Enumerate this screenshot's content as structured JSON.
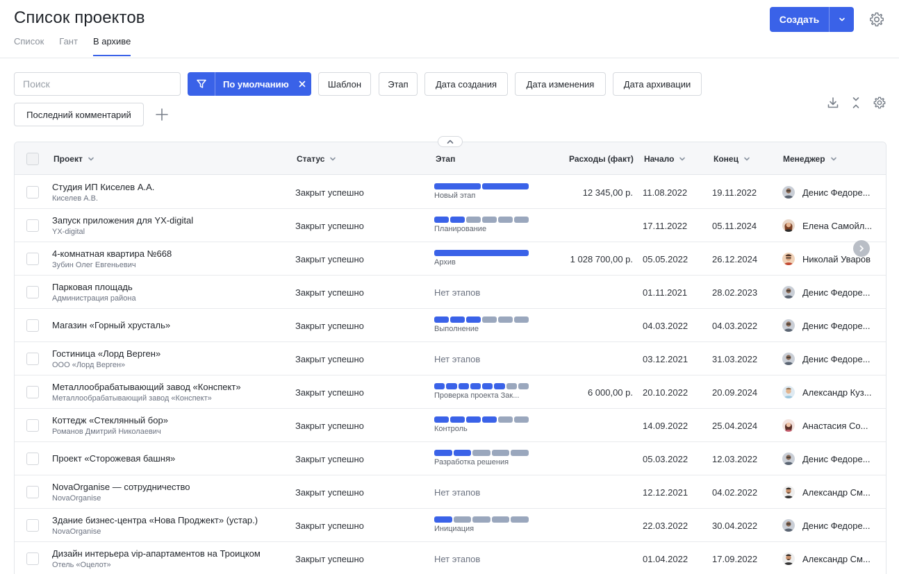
{
  "header": {
    "title": "Список проектов",
    "tabs": [
      {
        "label": "Список"
      },
      {
        "label": "Гант"
      },
      {
        "label": "В архиве"
      }
    ],
    "create_label": "Создать"
  },
  "filters": {
    "search_placeholder": "Поиск",
    "active_filter": "По умолчанию",
    "chips": [
      "Шаблон",
      "Этап",
      "Дата создания",
      "Дата изменения",
      "Дата архивации",
      "Последний комментарий"
    ]
  },
  "colors": {
    "accent": "#3a62e8",
    "stage_done": "#3a62e8",
    "stage_todo": "#9aa7bd"
  },
  "table": {
    "columns": {
      "project": "Проект",
      "status": "Статус",
      "stage": "Этап",
      "expenses": "Расходы (факт)",
      "start": "Начало",
      "end": "Конец",
      "manager": "Менеджер"
    },
    "rows": [
      {
        "name": "Студия ИП Киселев А.А.",
        "client": "Киселев А.В.",
        "status": "Закрыт успешно",
        "stage": {
          "label": "Новый этап",
          "done": 2,
          "total": 2
        },
        "expenses": "12 345,00 р.",
        "start": "11.08.2022",
        "end": "19.11.2022",
        "manager": "Денис Федоре...",
        "avatar": "m1"
      },
      {
        "name": "Запуск приложения для YX-digital",
        "client": "YX-digital",
        "status": "Закрыт успешно",
        "stage": {
          "label": "Планирование",
          "done": 2,
          "total": 6
        },
        "expenses": "",
        "start": "17.11.2022",
        "end": "05.11.2024",
        "manager": "Елена Самойл...",
        "avatar": "f1"
      },
      {
        "name": "4-комнатная квартира №668",
        "client": "Зубин Олег Евгеньевич",
        "status": "Закрыт успешно",
        "stage": {
          "label": "Архив",
          "done": 1,
          "total": 1
        },
        "expenses": "1 028 700,00 р.",
        "start": "05.05.2022",
        "end": "26.12.2024",
        "manager": "Николай Уваров",
        "avatar": "m2"
      },
      {
        "name": "Парковая площадь",
        "client": "Администрация района",
        "status": "Закрыт успешно",
        "stage": null,
        "no_stage": "Нет этапов",
        "expenses": "",
        "start": "01.11.2021",
        "end": "28.02.2023",
        "manager": "Денис Федоре...",
        "avatar": "m1"
      },
      {
        "name": "Магазин «Горный хрусталь»",
        "client": "",
        "status": "Закрыт успешно",
        "stage": {
          "label": "Выполнение",
          "done": 3,
          "total": 6
        },
        "expenses": "",
        "start": "04.03.2022",
        "end": "04.03.2022",
        "manager": "Денис Федоре...",
        "avatar": "m1"
      },
      {
        "name": "Гостиница «Лорд Верген»",
        "client": "ООО «Лорд Верген»",
        "status": "Закрыт успешно",
        "stage": null,
        "no_stage": "Нет этапов",
        "expenses": "",
        "start": "03.12.2021",
        "end": "31.03.2022",
        "manager": "Денис Федоре...",
        "avatar": "m1"
      },
      {
        "name": "Металлообрабатывающий завод «Конспект»",
        "client": "Металлообрабатывающий завод «Конспект»",
        "status": "Закрыт успешно",
        "stage": {
          "label": "Проверка проекта Зак...",
          "done": 6,
          "total": 8
        },
        "expenses": "6 000,00 р.",
        "start": "20.10.2022",
        "end": "20.09.2024",
        "manager": "Александр Куз...",
        "avatar": "m3"
      },
      {
        "name": "Коттедж «Стеклянный бор»",
        "client": "Романов Дмитрий Николаевич",
        "status": "Закрыт успешно",
        "stage": {
          "label": "Контроль",
          "done": 4,
          "total": 6
        },
        "expenses": "",
        "start": "14.09.2022",
        "end": "25.04.2024",
        "manager": "Анастасия Со...",
        "avatar": "f2"
      },
      {
        "name": "Проект «Сторожевая башня»",
        "client": "",
        "status": "Закрыт успешно",
        "stage": {
          "label": "Разработка решения",
          "done": 2,
          "total": 5
        },
        "expenses": "",
        "start": "05.03.2022",
        "end": "12.03.2022",
        "manager": "Денис Федоре...",
        "avatar": "m1"
      },
      {
        "name": "NovaOrganise — сотрудничество",
        "client": "NovaOrganise",
        "status": "Закрыт успешно",
        "stage": null,
        "no_stage": "Нет этапов",
        "expenses": "",
        "start": "12.12.2021",
        "end": "04.02.2022",
        "manager": "Александр См...",
        "avatar": "m4"
      },
      {
        "name": "Здание бизнес-центра «Нова Проджект» (устар.)",
        "client": "NovaOrganise",
        "status": "Закрыт успешно",
        "stage": {
          "label": "Инициация",
          "done": 1,
          "total": 5
        },
        "expenses": "",
        "start": "22.03.2022",
        "end": "30.04.2022",
        "manager": "Денис Федоре...",
        "avatar": "m1"
      },
      {
        "name": "Дизайн интерьера vip-апартаментов на Троицком",
        "client": "Отель «Оцелот»",
        "status": "Закрыт успешно",
        "stage": null,
        "no_stage": "Нет этапов",
        "expenses": "",
        "start": "01.04.2022",
        "end": "17.09.2022",
        "manager": "Александр См...",
        "avatar": "m4"
      }
    ]
  }
}
